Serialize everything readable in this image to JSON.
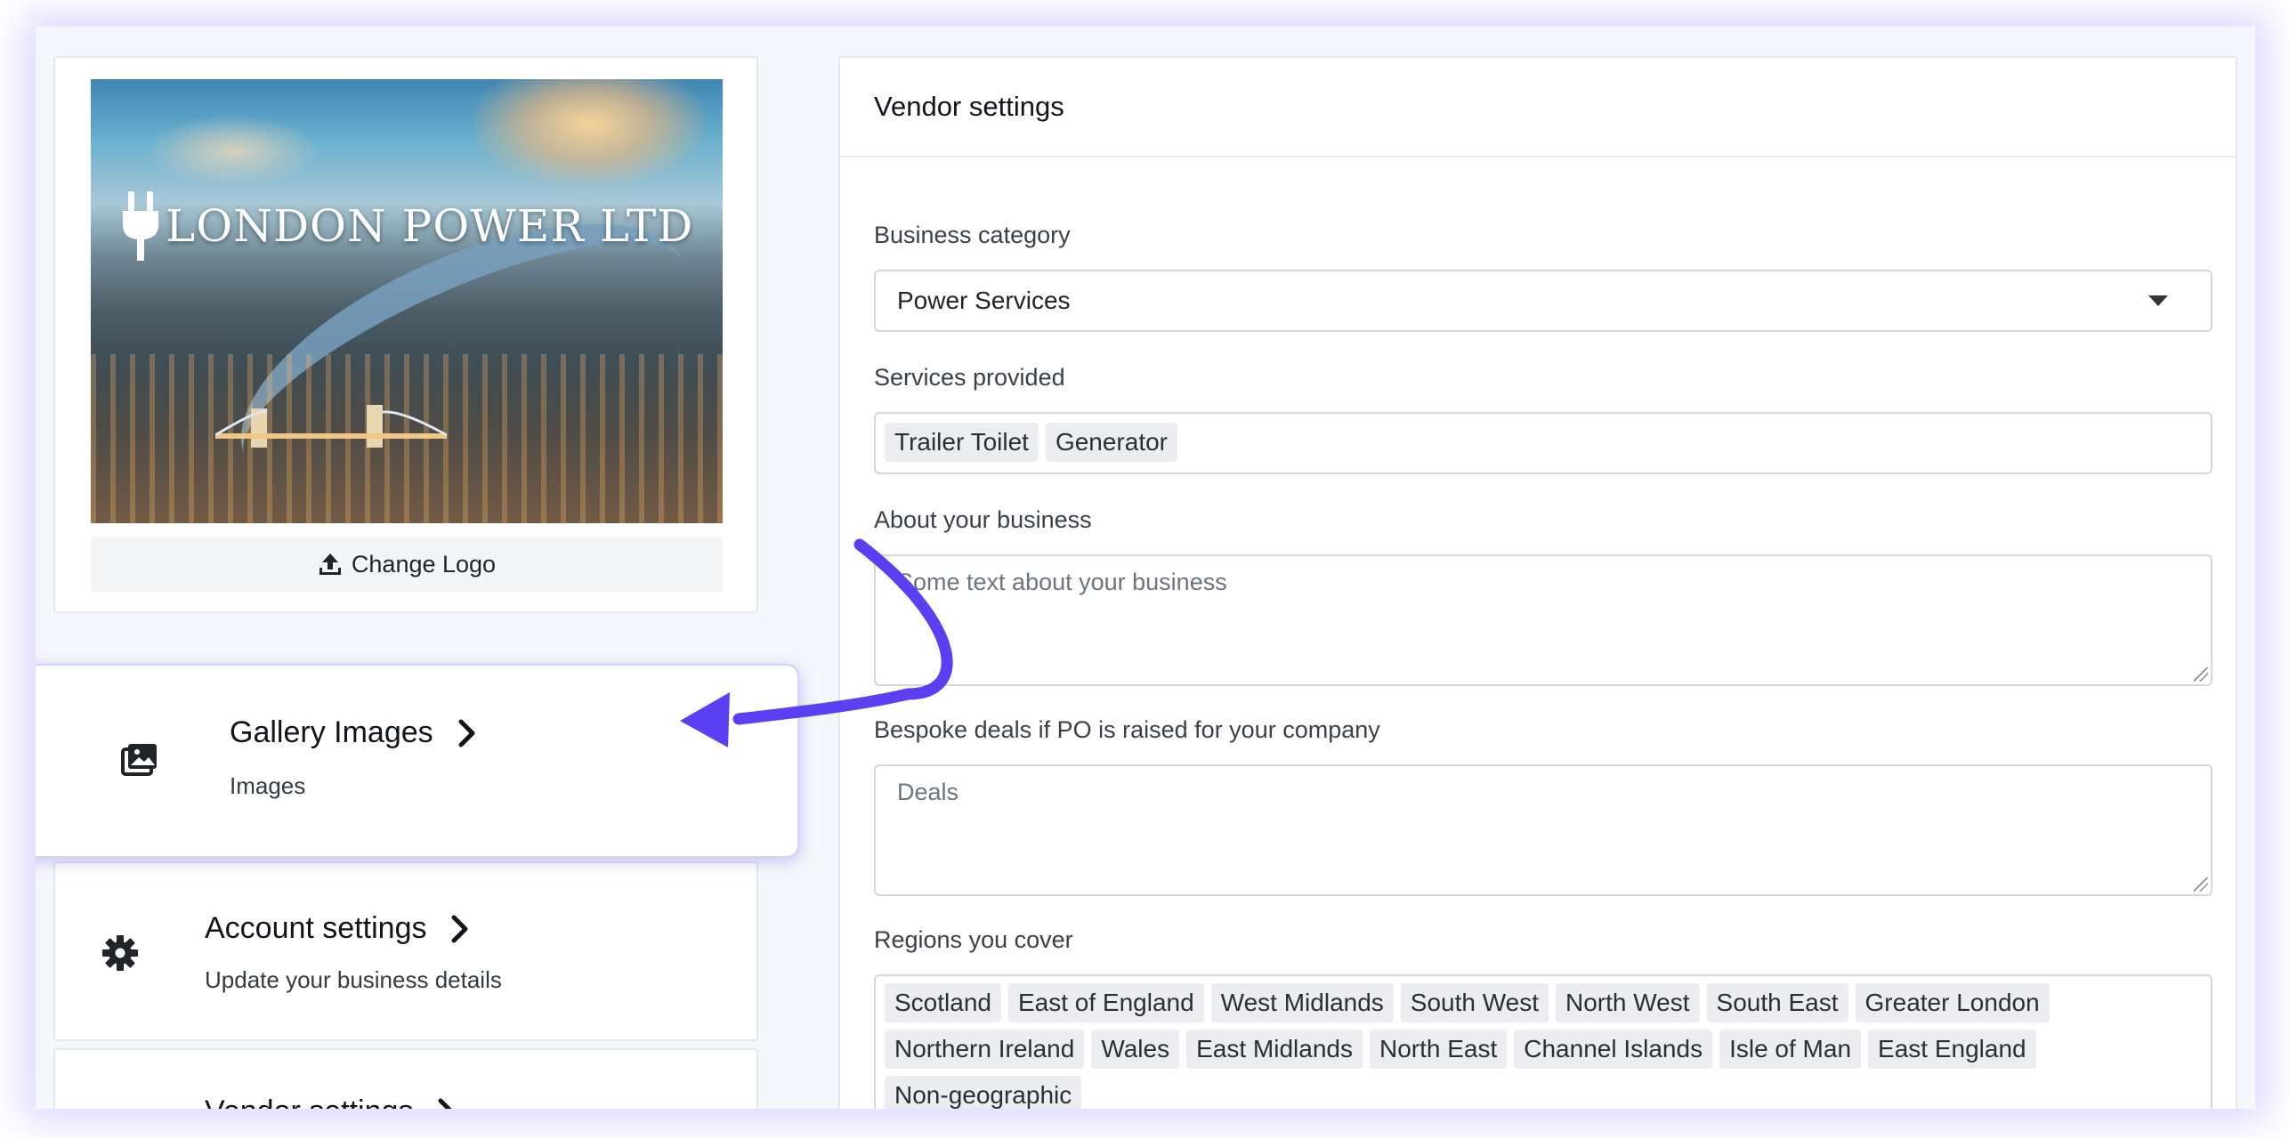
{
  "logo": {
    "brand_text": "LONDON POWER LTD",
    "change_logo_label": "Change Logo"
  },
  "side_cards": {
    "gallery": {
      "title": "Gallery Images",
      "subtitle": "Images"
    },
    "account": {
      "title": "Account settings",
      "subtitle": "Update your business details"
    },
    "vendor": {
      "title": "Vendor settings"
    }
  },
  "vendor_settings": {
    "header": "Vendor settings",
    "business_category": {
      "label": "Business category",
      "value": "Power Services"
    },
    "services_provided": {
      "label": "Services provided",
      "tags": [
        "Trailer Toilet",
        "Generator"
      ]
    },
    "about": {
      "label": "About your business",
      "placeholder": "Some text about your business"
    },
    "deals": {
      "label": "Bespoke deals if PO is raised for your company",
      "placeholder": "Deals"
    },
    "regions": {
      "label": "Regions you cover",
      "tags": [
        "Scotland",
        "East of England",
        "West Midlands",
        "South West",
        "North West",
        "South East",
        "Greater London",
        "Northern Ireland",
        "Wales",
        "East Midlands",
        "North East",
        "Channel Islands",
        "Isle of Man",
        "East England",
        "Non-geographic"
      ]
    }
  },
  "colors": {
    "accent_arrow": "#5b3ff2",
    "frame_glow": "#846eff",
    "tag_bg": "#ebedf0"
  },
  "icons": {
    "gallery": "gallery-icon",
    "account": "gear-icon",
    "upload": "upload-icon",
    "chevron": "chevron-right-icon",
    "plug": "plug-icon"
  }
}
